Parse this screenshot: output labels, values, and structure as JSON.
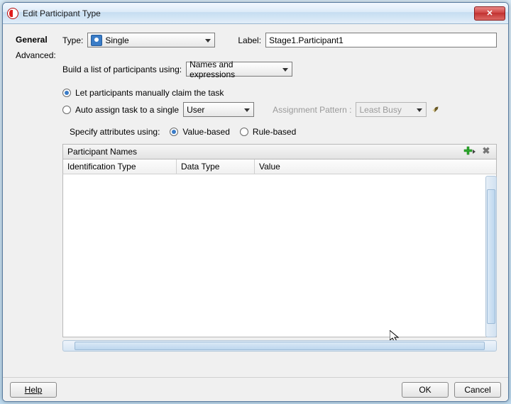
{
  "window": {
    "title": "Edit Participant Type"
  },
  "tabs": {
    "general": "General",
    "advanced": "Advanced:"
  },
  "form": {
    "type_label": "Type:",
    "type_value": "Single",
    "label_label": "Label:",
    "label_value": "Stage1.Participant1",
    "build_list_label": "Build a list of participants using:",
    "build_list_value": "Names and expressions",
    "claim_manually": "Let participants manually claim the task",
    "auto_assign_prefix": "Auto assign task to a single",
    "auto_assign_target": "User",
    "assignment_pattern_label": "Assignment Pattern :",
    "assignment_pattern_value": "Least Busy",
    "specify_attrs_label": "Specify attributes using:",
    "value_based": "Value-based",
    "rule_based": "Rule-based"
  },
  "table": {
    "section_title": "Participant Names",
    "col1": "Identification Type",
    "col2": "Data Type",
    "col3": "Value"
  },
  "buttons": {
    "help": "Help",
    "ok": "OK",
    "cancel": "Cancel"
  }
}
